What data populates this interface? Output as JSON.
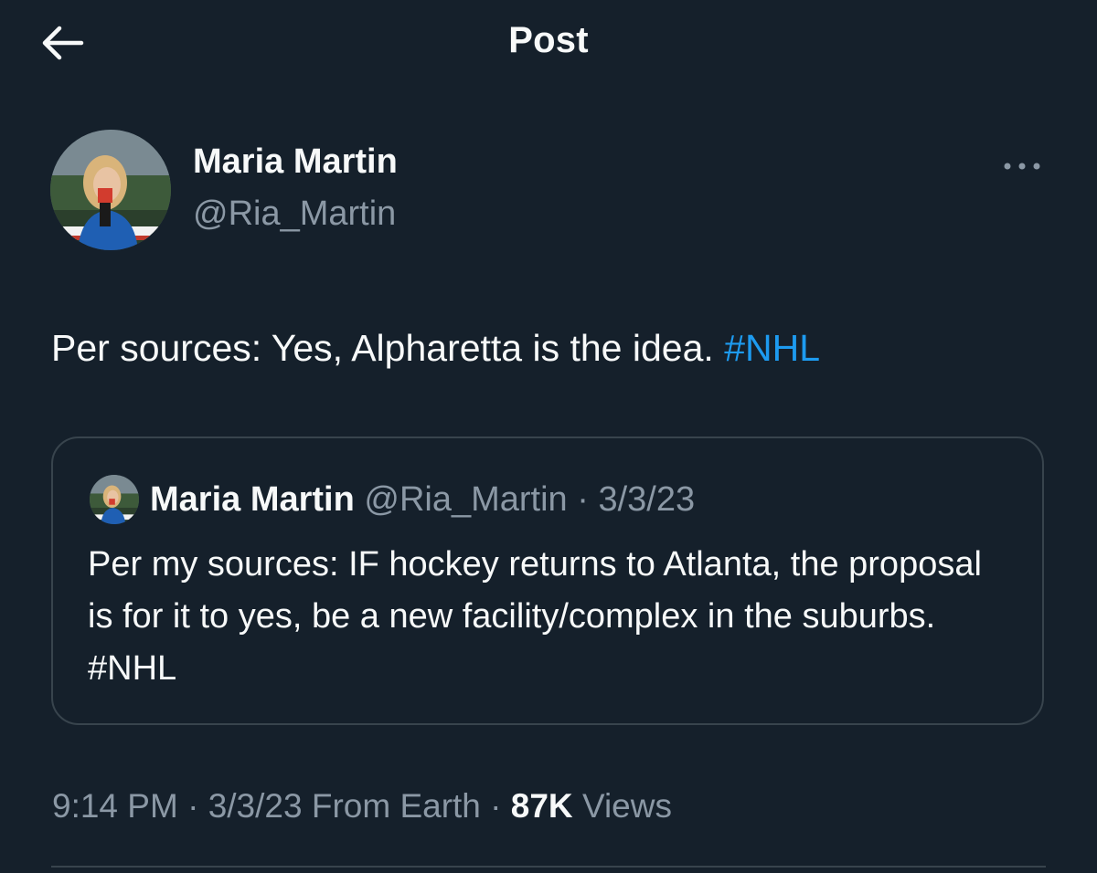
{
  "header": {
    "title": "Post",
    "back_icon": "arrow-left-icon"
  },
  "author": {
    "name": "Maria Martin",
    "handle": "@Ria_Martin"
  },
  "tweet": {
    "text": "Per sources: Yes, Alpharetta is the idea. ",
    "hashtag": "#NHL"
  },
  "quote": {
    "name": "Maria Martin",
    "handle": "@Ria_Martin",
    "separator": "·",
    "date": "3/3/23",
    "text": "Per my sources: IF hockey returns to Atlanta, the proposal is for it to yes, be a new facility/complex in the suburbs. #NHL"
  },
  "meta": {
    "time": "9:14 PM",
    "sep1": "·",
    "date": "3/3/23",
    "source": "From Earth",
    "sep2": "·",
    "views_count": "87K",
    "views_label": "Views"
  },
  "colors": {
    "background": "#15202b",
    "text": "#f7f9f9",
    "secondary": "#8b98a5",
    "accent": "#1d9bf0",
    "border": "#38444d"
  }
}
